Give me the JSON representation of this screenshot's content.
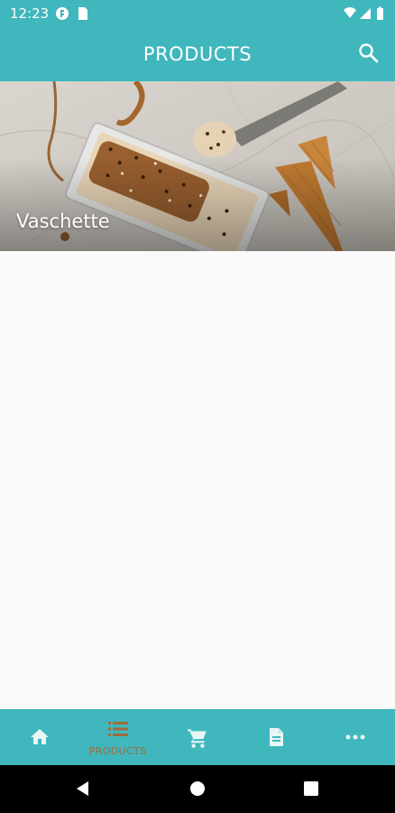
{
  "status_bar": {
    "time": "12:23"
  },
  "app_bar": {
    "title": "PRODUCTS"
  },
  "banner": {
    "label": "Vaschette"
  },
  "bottom_nav": {
    "items": [
      {
        "icon": "home-icon",
        "label": ""
      },
      {
        "icon": "list-icon",
        "label": "PRODUCTS",
        "active": true
      },
      {
        "icon": "cart-icon",
        "label": ""
      },
      {
        "icon": "document-icon",
        "label": ""
      },
      {
        "icon": "more-icon",
        "label": ""
      }
    ]
  },
  "colors": {
    "primary": "#3fb7bd",
    "active_label": "#a06b3a",
    "background": "#fafafa"
  }
}
